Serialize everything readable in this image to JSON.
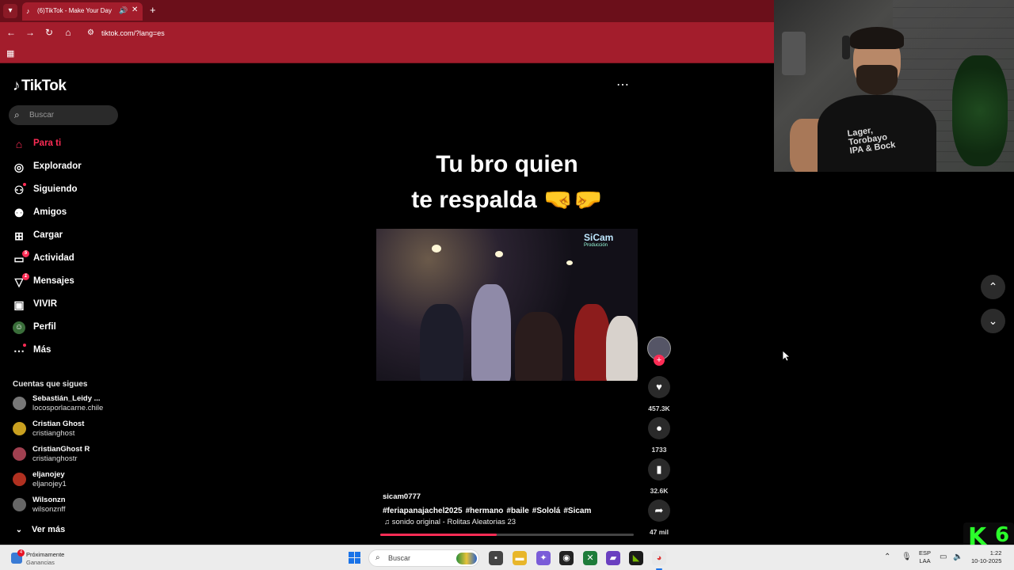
{
  "browser": {
    "tab_title": "(6)TikTok - Make Your Day",
    "url": "tiktok.com/?lang=es"
  },
  "sidebar": {
    "logo": "TikTok",
    "search_placeholder": "Buscar",
    "nav": [
      {
        "label": "Para ti",
        "icon": "home-icon",
        "active": true
      },
      {
        "label": "Explorador",
        "icon": "compass-icon"
      },
      {
        "label": "Siguiendo",
        "icon": "following-icon"
      },
      {
        "label": "Amigos",
        "icon": "friends-icon"
      },
      {
        "label": "Cargar",
        "icon": "upload-icon"
      },
      {
        "label": "Actividad",
        "icon": "activity-icon",
        "badge": "5"
      },
      {
        "label": "Mensajes",
        "icon": "messages-icon",
        "badge": "1"
      },
      {
        "label": "VIVIR",
        "icon": "live-icon"
      },
      {
        "label": "Perfil",
        "icon": "profile-icon"
      },
      {
        "label": "Más",
        "icon": "more-icon"
      }
    ],
    "following_title": "Cuentas que sigues",
    "accounts": [
      {
        "name": "Sebastián_Leidy ...",
        "username": "locosporlacarne.chile"
      },
      {
        "name": "Cristian Ghost",
        "username": "cristianghost"
      },
      {
        "name": "CristianGhost R",
        "username": "cristianghostr"
      },
      {
        "name": "eljanojey",
        "username": "eljanojey1"
      },
      {
        "name": "Wilsonzn",
        "username": "wilsonznff"
      }
    ],
    "see_more": "Ver más"
  },
  "video": {
    "caption_line1": "Tu bro quien",
    "caption_line2": "te respalda 🤜🤛",
    "watermark": "SiCam",
    "watermark_sub": "Producción",
    "author": "sicam0777",
    "hashtags": [
      "#feriapanajachel2025",
      "#hermano",
      "#baile",
      "#Sololá",
      "#Sicam"
    ],
    "music": "sonido original - Rolitas Aleatorias 23",
    "progress": 0.46,
    "likes": "457.3K",
    "comments": "1733",
    "saves": "32.6K",
    "shares": "47 mil"
  },
  "webcam": {
    "shirt_text": "Lager, Torobayo IPA & Bock"
  },
  "overlay": {
    "k6_k": "K",
    "k6_num": "6"
  },
  "taskbar": {
    "news_title": "Próximamente",
    "news_sub": "Ganancias",
    "news_badge": "4",
    "search_placeholder": "Buscar",
    "lang1": "ESP",
    "lang2": "LAA",
    "time": "1:22",
    "date": "10-10-2025"
  }
}
